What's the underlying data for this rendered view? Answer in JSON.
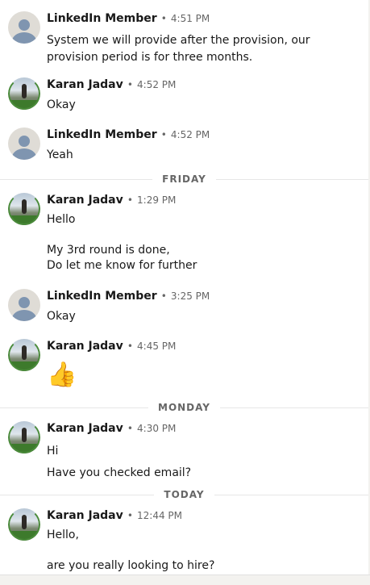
{
  "messages": [
    {
      "sender": "LinkedIn Member",
      "avatar": "default-avatar",
      "time": "4:51 PM",
      "lines": [
        "System we will provide after the provision, our",
        "provision period is for three months."
      ]
    },
    {
      "sender": "Karan Jadav",
      "avatar": "photo-avatar",
      "time": "4:52 PM",
      "lines": [
        "Okay"
      ]
    },
    {
      "sender": "LinkedIn Member",
      "avatar": "default-avatar",
      "time": "4:52 PM",
      "lines": [
        "Yeah"
      ]
    },
    {
      "sender": "Karan Jadav",
      "avatar": "photo-avatar",
      "time": "1:29 PM",
      "lines": [
        "Hello",
        "",
        "My 3rd round is done,",
        "Do let me know for further"
      ]
    },
    {
      "sender": "LinkedIn Member",
      "avatar": "default-avatar",
      "time": "3:25 PM",
      "lines": [
        "Okay"
      ]
    },
    {
      "sender": "Karan Jadav",
      "avatar": "photo-avatar",
      "time": "4:45 PM",
      "emoji": "👍"
    },
    {
      "sender": "Karan Jadav",
      "avatar": "photo-avatar",
      "time": "4:30 PM",
      "lines": [
        "Hi",
        "Have you checked email?"
      ]
    },
    {
      "sender": "Karan Jadav",
      "avatar": "photo-avatar",
      "time": "12:44 PM",
      "lines": [
        "Hello,",
        "",
        "are you really looking to hire?"
      ]
    }
  ],
  "dividers": [
    "FRIDAY",
    "MONDAY",
    "TODAY"
  ],
  "separator": "•",
  "colors": {
    "divider_line": "#e6e6e6",
    "meta_gray": "#666666",
    "default_avatar_bg": "#dfdcd6",
    "default_avatar_fg": "#7f95b0",
    "badge_green": "#3d7a2c"
  }
}
